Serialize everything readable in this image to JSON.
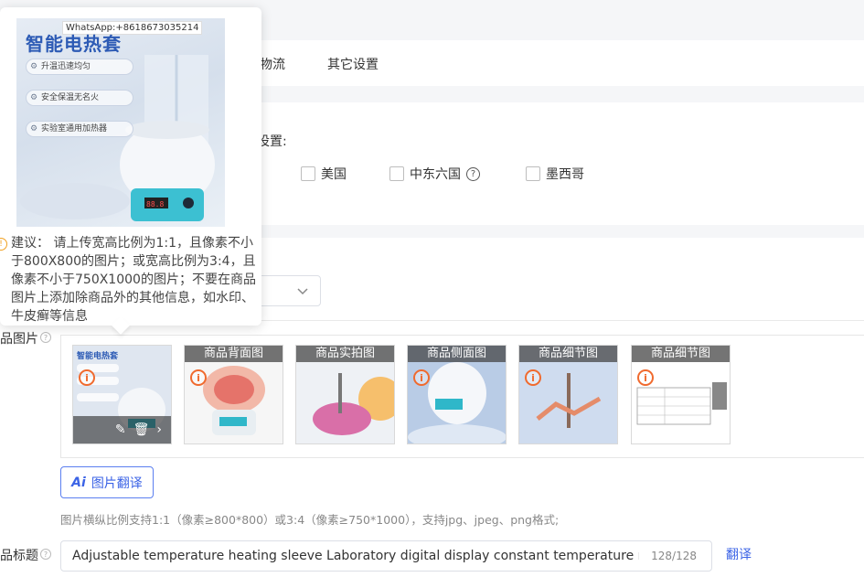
{
  "tabs": [
    {
      "label": "物流"
    },
    {
      "label": "其它设置"
    }
  ],
  "intl": {
    "title": "化设置:",
    "options": [
      {
        "label": "美国"
      },
      {
        "label": "中东六国"
      },
      {
        "label": "墨西哥"
      }
    ]
  },
  "images_section": {
    "label": "品图片",
    "thumbnails": [
      {
        "caption": ""
      },
      {
        "caption": "商品背面图"
      },
      {
        "caption": "商品实拍图"
      },
      {
        "caption": "商品侧面图"
      },
      {
        "caption": "商品细节图"
      },
      {
        "caption": "商品细节图"
      }
    ],
    "translate_button": "图片翻译",
    "translate_ai": "Ai",
    "hint": "图片横纵比例支持1:1（像素≥800*800）或3:4（像素≥750*1000），支持jpg、jpeg、png格式;"
  },
  "title_field": {
    "label": "品标题",
    "value": "Adjustable temperature heating sleeve Laboratory digital display constant temperature magnetic stirring heating mantle",
    "count": "128/128",
    "translate_link": "翻译"
  },
  "popover": {
    "watermark": "WhatsApp:+8618673035214",
    "heading": "智能电热套",
    "features": [
      "升温迅速均匀",
      "安全保温无名火",
      "实验室通用加热器"
    ],
    "tip": "建议： 请上传宽高比例为1:1，且像素不小于800X800的图片；或宽高比例为3:4，且像素不小于750X1000的图片；不要在商品图片上添加除商品外的其他信息，如水印、牛皮癣等信息"
  },
  "colors": {
    "accent": "#3b63e6",
    "warning": "#f06a2e"
  }
}
